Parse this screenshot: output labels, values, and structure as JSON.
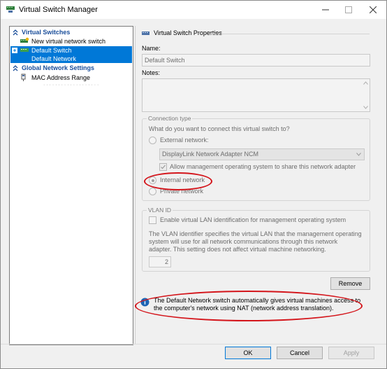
{
  "window": {
    "title": "Virtual Switch Manager"
  },
  "sidebar": {
    "virtual_switches_header": "Virtual Switches",
    "new_switch_label": "New virtual network switch",
    "default_switch_name": "Default Switch",
    "default_switch_subtitle": "Default Network",
    "global_settings_header": "Global Network Settings",
    "mac_range_label": "MAC Address Range",
    "mac_range_value": "· · · · · · · · · · · · · · · · · ·  ·"
  },
  "properties": {
    "header": "Virtual Switch Properties",
    "name_label": "Name:",
    "name_value": "Default Switch",
    "notes_label": "Notes:",
    "notes_value": "",
    "connection_type": {
      "title": "Connection type",
      "question": "What do you want to connect this virtual switch to?",
      "external_label": "External network:",
      "adapter_selected": "DisplayLink Network Adapter NCM",
      "allow_mgmt_label": "Allow management operating system to share this network adapter",
      "internal_label": "Internal network",
      "private_label": "Private network"
    },
    "vlan": {
      "title": "VLAN ID",
      "enable_label": "Enable virtual LAN identification for management operating system",
      "description": "The VLAN identifier specifies the virtual LAN that the management operating system will use for all network communications through this network adapter. This setting does not affect virtual machine networking.",
      "vlan_value": "2"
    },
    "remove_label": "Remove",
    "info_text": "The Default Network switch automatically gives virtual machines access to the computer's network using NAT (network address translation)."
  },
  "footer": {
    "ok_label": "OK",
    "cancel_label": "Cancel",
    "apply_label": "Apply"
  },
  "colors": {
    "selection": "#0078d7",
    "section_header": "#1a4e9a",
    "annotation_ring": "#d4151b",
    "info_icon": "#1c64b4"
  }
}
